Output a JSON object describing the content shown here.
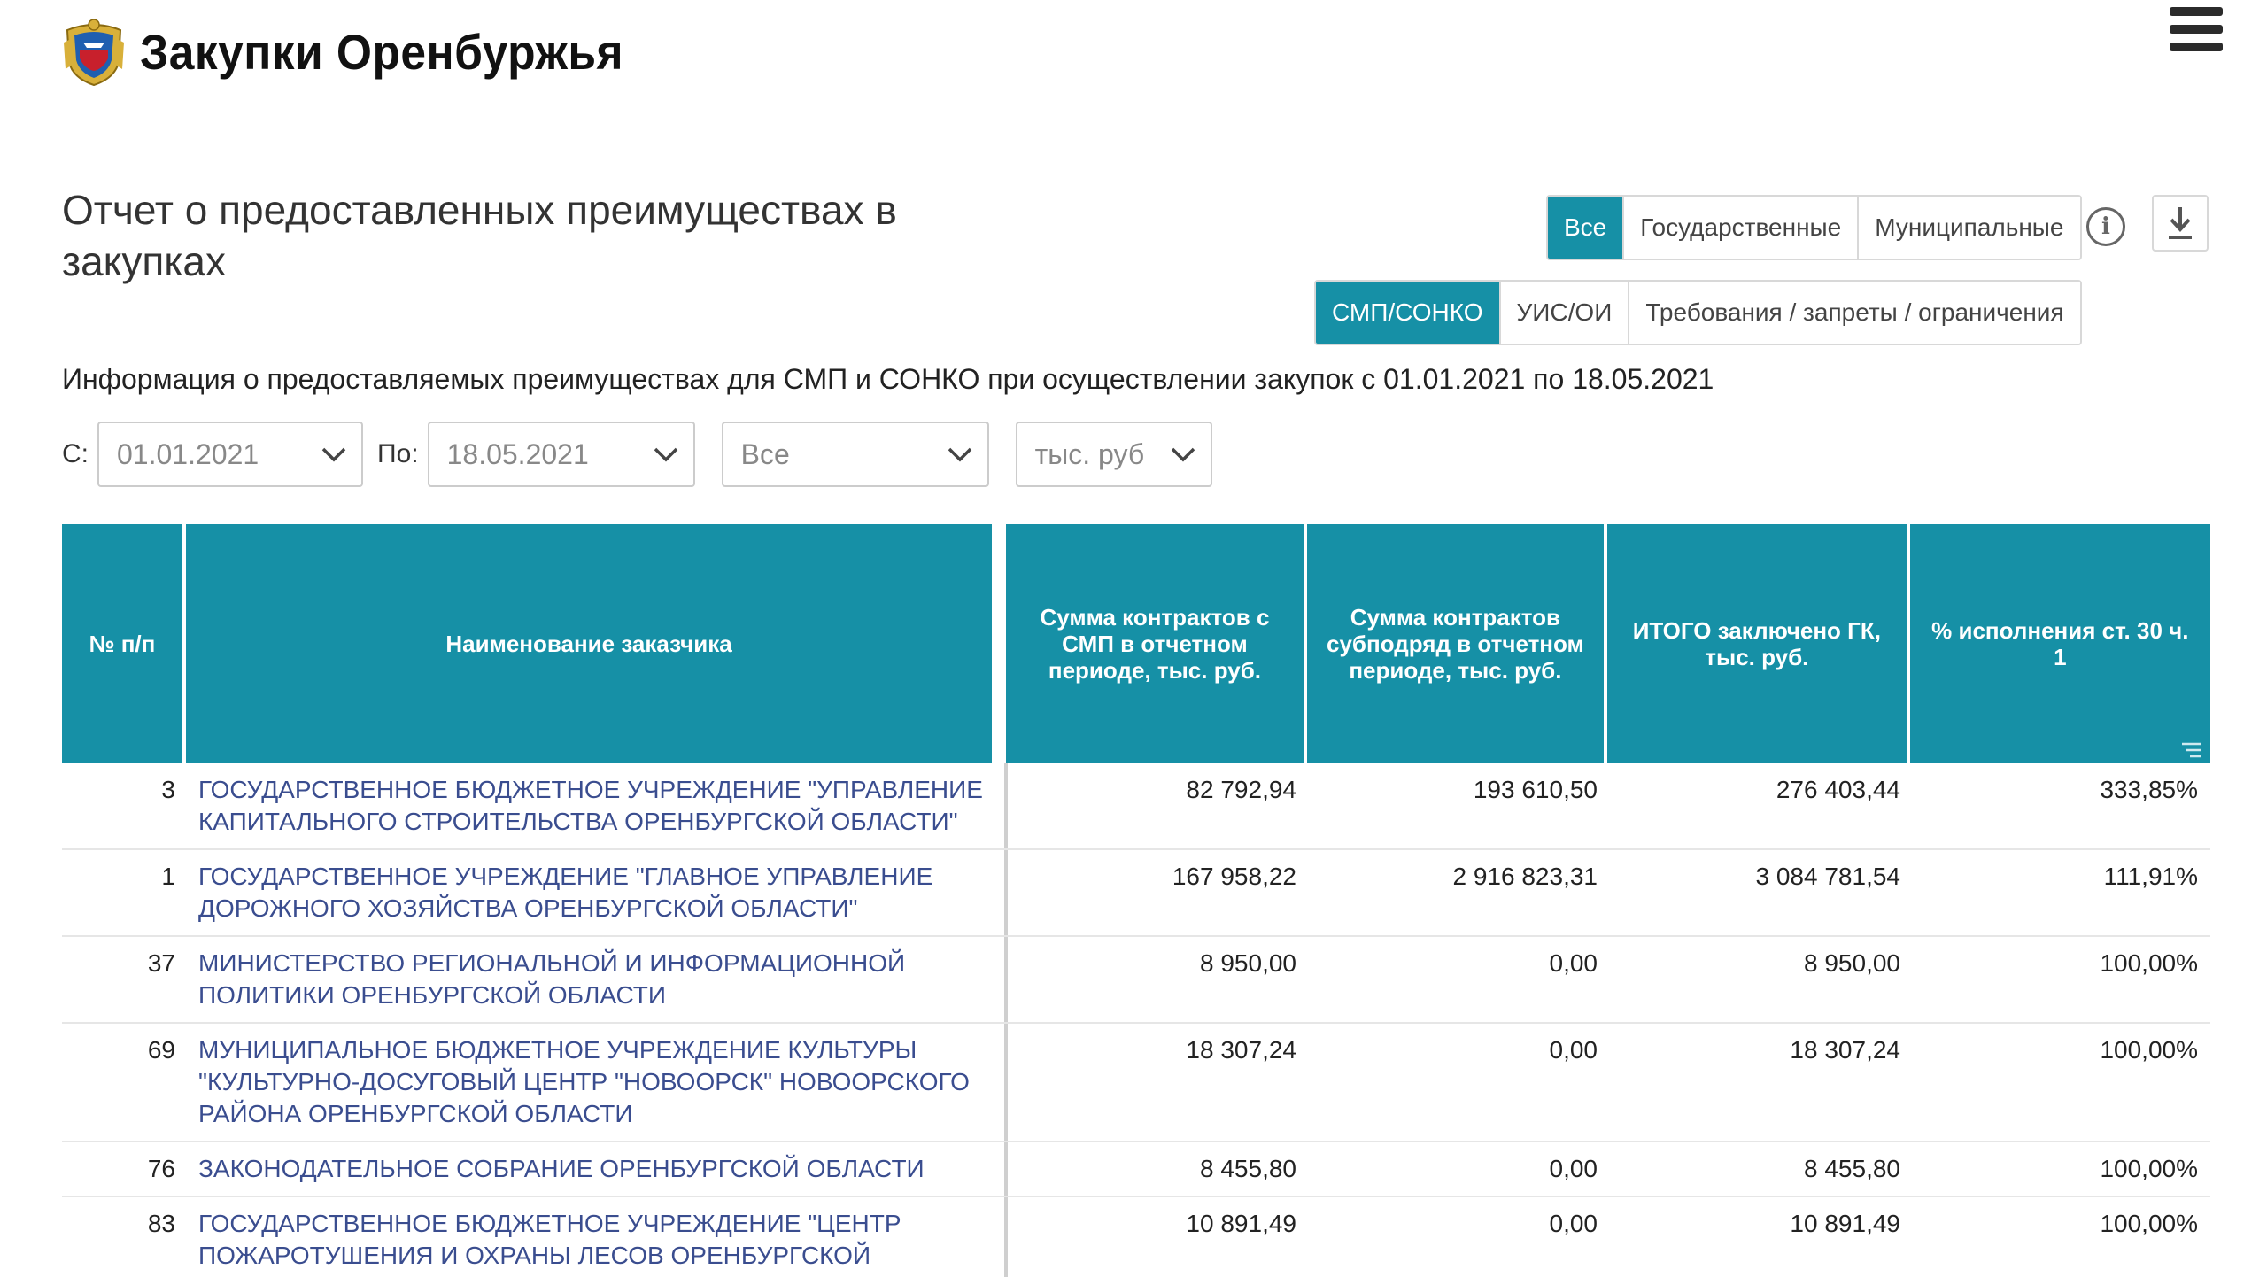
{
  "header": {
    "site_title": "Закупки Оренбуржья"
  },
  "page": {
    "title": "Отчет о предоставленных преимуществах в закупках",
    "info_text": "Информация о предоставляемых преимуществах для СМП и СОНКО при осуществлении закупок с 01.01.2021 по 18.05.2021"
  },
  "scope_tabs": [
    {
      "label": "Все",
      "active": true
    },
    {
      "label": "Государственные",
      "active": false
    },
    {
      "label": "Муниципальные",
      "active": false
    }
  ],
  "type_tabs": [
    {
      "label": "СМП/СОНКО",
      "active": true
    },
    {
      "label": "УИС/ОИ",
      "active": false
    },
    {
      "label": "Требования / запреты / ограничения",
      "active": false
    }
  ],
  "filters": {
    "from_label": "С:",
    "from_value": "01.01.2021",
    "to_label": "По:",
    "to_value": "18.05.2021",
    "level_value": "Все",
    "unit_value": "тыс. руб"
  },
  "table": {
    "headers": [
      "№ п/п",
      "Наименование заказчика",
      "Сумма контрактов с СМП в отчетном периоде, тыс. руб.",
      "Сумма контрактов субподряд в отчетном периоде, тыс. руб.",
      "ИТОГО заключено ГК, тыс. руб.",
      "% исполнения ст. 30 ч. 1"
    ],
    "rows": [
      {
        "n": "3",
        "name": "ГОСУДАРСТВЕННОЕ БЮДЖЕТНОЕ УЧРЕЖДЕНИЕ \"УПРАВЛЕНИЕ КАПИТАЛЬНОГО СТРОИТЕЛЬСТВА ОРЕНБУРГСКОЙ ОБЛАСТИ\"",
        "smp": "82 792,94",
        "sub": "193 610,50",
        "total": "276 403,44",
        "pct": "333,85%"
      },
      {
        "n": "1",
        "name": "ГОСУДАРСТВЕННОЕ УЧРЕЖДЕНИЕ \"ГЛАВНОЕ УПРАВЛЕНИЕ ДОРОЖНОГО ХОЗЯЙСТВА ОРЕНБУРГСКОЙ ОБЛАСТИ\"",
        "smp": "167 958,22",
        "sub": "2 916 823,31",
        "total": "3 084 781,54",
        "pct": "111,91%"
      },
      {
        "n": "37",
        "name": "МИНИСТЕРСТВО РЕГИОНАЛЬНОЙ И ИНФОРМАЦИОННОЙ ПОЛИТИКИ ОРЕНБУРГСКОЙ ОБЛАСТИ",
        "smp": "8 950,00",
        "sub": "0,00",
        "total": "8 950,00",
        "pct": "100,00%"
      },
      {
        "n": "69",
        "name": "МУНИЦИПАЛЬНОЕ БЮДЖЕТНОЕ УЧРЕЖДЕНИЕ КУЛЬТУРЫ \"КУЛЬТУРНО-ДОСУГОВЫЙ ЦЕНТР \"НОВООРСК\" НОВООРСКОГО РАЙОНА ОРЕНБУРГСКОЙ ОБЛАСТИ",
        "smp": "18 307,24",
        "sub": "0,00",
        "total": "18 307,24",
        "pct": "100,00%"
      },
      {
        "n": "76",
        "name": "ЗАКОНОДАТЕЛЬНОЕ СОБРАНИЕ ОРЕНБУРГСКОЙ ОБЛАСТИ",
        "smp": "8 455,80",
        "sub": "0,00",
        "total": "8 455,80",
        "pct": "100,00%"
      },
      {
        "n": "83",
        "name": "ГОСУДАРСТВЕННОЕ БЮДЖЕТНОЕ УЧРЕЖДЕНИЕ \"ЦЕНТР ПОЖАРОТУШЕНИЯ И ОХРАНЫ ЛЕСОВ ОРЕНБУРГСКОЙ ОБЛАСТИ\"",
        "smp": "10 891,49",
        "sub": "0,00",
        "total": "10 891,49",
        "pct": "100,00%"
      }
    ]
  },
  "icons": {
    "emblem": "coat-of-arms-icon",
    "menu": "hamburger-menu-icon",
    "info": "info-icon",
    "download": "download-icon",
    "chevron": "chevron-down-icon",
    "column_filter": "column-filter-icon"
  },
  "colors": {
    "accent": "#1690a6",
    "link": "#3a4d8f"
  }
}
